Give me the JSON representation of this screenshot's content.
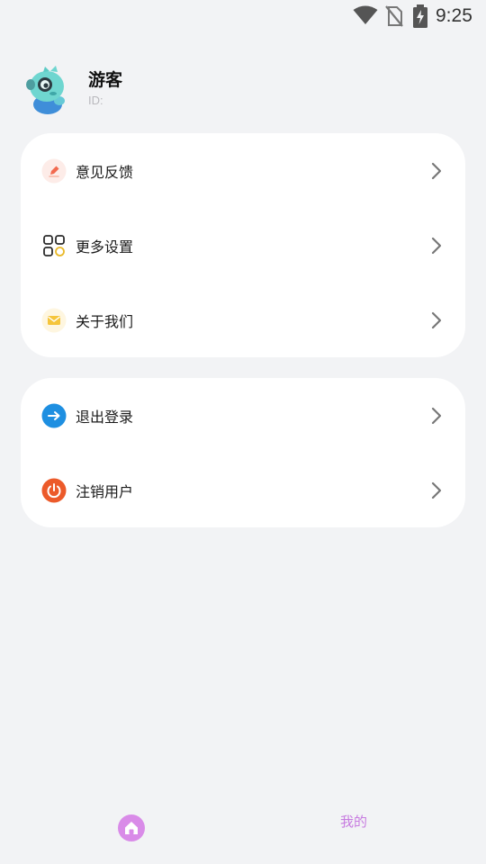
{
  "status_bar": {
    "time": "9:25",
    "icons": [
      "wifi-icon",
      "no-sim-icon",
      "battery-charging-icon"
    ]
  },
  "profile": {
    "name": "游客",
    "id_label": "ID:"
  },
  "menu_group_1": [
    {
      "label": "意见反馈",
      "icon": "feedback-pen-icon",
      "color": "#f26a4f"
    },
    {
      "label": "更多设置",
      "icon": "grid-settings-icon",
      "color": "#2b2b2b"
    },
    {
      "label": "关于我们",
      "icon": "mail-icon",
      "color": "#f5c53b"
    }
  ],
  "menu_group_2": [
    {
      "label": "退出登录",
      "icon": "logout-arrow-icon",
      "color": "#1e8fe1"
    },
    {
      "label": "注销用户",
      "icon": "power-icon",
      "color": "#ec5a2a"
    }
  ],
  "bottom_nav": {
    "mine_label": "我的",
    "accent": "#c77be0",
    "home_icon": "home-icon"
  }
}
